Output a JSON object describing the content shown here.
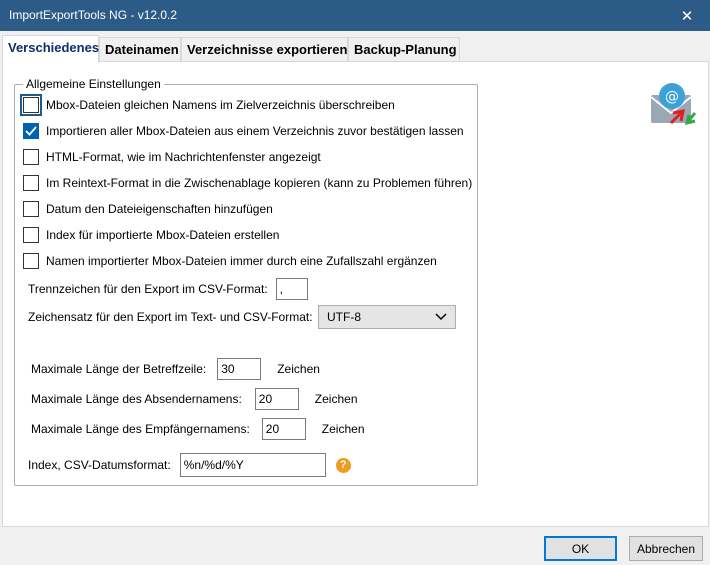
{
  "window": {
    "title": "ImportExportTools NG - v12.0.2",
    "close_glyph": "✕"
  },
  "tabs": [
    {
      "label": "Verschiedenes",
      "active": true
    },
    {
      "label": "Dateinamen",
      "active": false
    },
    {
      "label": "Verzeichnisse exportieren",
      "active": false
    },
    {
      "label": "Backup-Planung",
      "active": false
    }
  ],
  "group": {
    "legend": "Allgemeine Einstellungen",
    "checkboxes": [
      {
        "label": "Mbox-Dateien gleichen Namens im Zielverzeichnis überschreiben",
        "checked": false
      },
      {
        "label": "Importieren aller Mbox-Dateien aus einem Verzeichnis zuvor bestätigen lassen",
        "checked": true
      },
      {
        "label": "HTML-Format, wie im Nachrichtenfenster angezeigt",
        "checked": false
      },
      {
        "label": "Im Reintext-Format in die Zwischenablage kopieren (kann zu Problemen führen)",
        "checked": false
      },
      {
        "label": "Datum den Dateieigenschaften hinzufügen",
        "checked": false
      },
      {
        "label": "Index für importierte Mbox-Dateien erstellen",
        "checked": false
      },
      {
        "label": "Namen importierter Mbox-Dateien immer durch eine Zufallszahl ergänzen",
        "checked": false
      }
    ],
    "csv_separator": {
      "label": "Trennzeichen für den Export im CSV-Format:",
      "value": ","
    },
    "charset": {
      "label": "Zeichensatz für den Export im Text- und CSV-Format:",
      "value": "UTF-8"
    },
    "max_subject": {
      "label": "Maximale Länge der Betreffzeile:",
      "value": "30",
      "unit": "Zeichen"
    },
    "max_sender": {
      "label": "Maximale Länge des Absendernamens:",
      "value": "20",
      "unit": "Zeichen"
    },
    "max_recipient": {
      "label": "Maximale Länge des Empfängernamens:",
      "value": "20",
      "unit": "Zeichen"
    },
    "date_format": {
      "label": "Index, CSV-Datumsformat:",
      "value": "%n/%d/%Y",
      "help": "?"
    }
  },
  "buttons": {
    "ok": "OK",
    "cancel": "Abbrechen"
  },
  "colors": {
    "titlebar": "#2c5b88",
    "accent": "#0063b1",
    "help": "#f19a1f"
  },
  "icons": {
    "logo": "mail-import-export-icon"
  }
}
